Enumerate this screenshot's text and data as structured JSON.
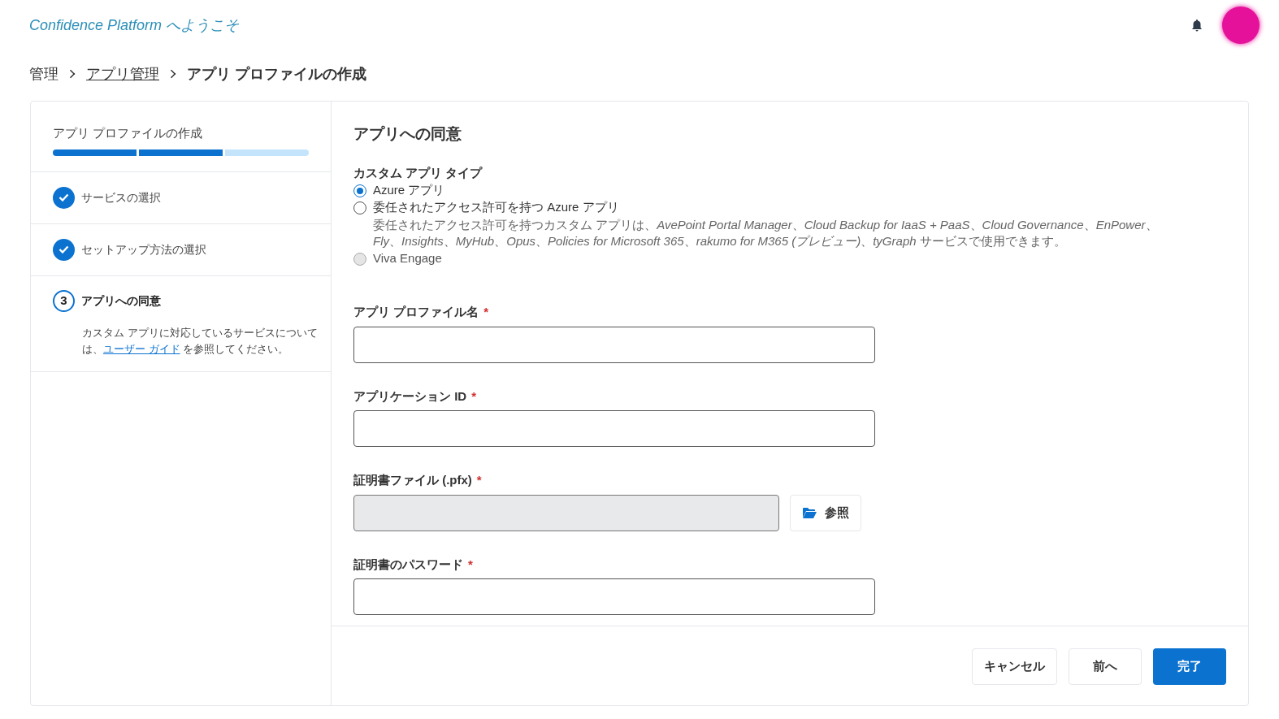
{
  "header": {
    "title": "Confidence Platform へようこそ"
  },
  "breadcrumb": [
    {
      "label": "管理",
      "link": false
    },
    {
      "label": "アプリ管理",
      "link": true
    },
    {
      "label": "アプリ プロファイルの作成",
      "link": false
    }
  ],
  "wizard": {
    "title": "アプリ プロファイルの作成",
    "progress": [
      {
        "filled": true
      },
      {
        "filled": true
      },
      {
        "filled": false
      }
    ],
    "steps": [
      {
        "completed": true,
        "selected": false,
        "label": "サービスの選択"
      },
      {
        "completed": true,
        "selected": false,
        "label": "セットアップ方法の選択"
      },
      {
        "completed": false,
        "selected": true,
        "marker": "3",
        "label": "アプリへの同意",
        "note_before": "カスタム アプリに対応しているサービスについては、",
        "note_link": "ユーザー ガイド",
        "note_after": " を参照してください。"
      }
    ]
  },
  "form": {
    "title": "アプリへの同意",
    "app_type": {
      "label": "カスタム アプリ タイプ",
      "options": [
        {
          "label": "Azure アプリ",
          "selected": true,
          "disabled": false
        },
        {
          "label": "委任されたアクセス許可を持つ Azure アプリ",
          "selected": false,
          "disabled": false,
          "description": "委任されたアクセス許可を持つカスタム アプリは、*AvePoint Portal Manager*、*Cloud Backup for IaaS + PaaS*、*Cloud Governance*、*EnPower*、*Fly*、*Insights*、*MyHub*、*Opus*、*Policies for Microsoft 365*、*rakumo for M365 (プレビュー)*、*tyGraph* サービスで使用できます。"
        },
        {
          "label": "Viva Engage",
          "selected": false,
          "disabled": true
        }
      ]
    },
    "fields": [
      {
        "kind": "text",
        "label": "アプリ プロファイル名",
        "required_mark": "*"
      },
      {
        "kind": "text",
        "label": "アプリケーション ID",
        "required_mark": "*"
      },
      {
        "kind": "file",
        "label": "証明書ファイル (.pfx)",
        "required_mark": "*",
        "button": "参照"
      },
      {
        "kind": "password",
        "label": "証明書のパスワード",
        "required_mark": "*"
      }
    ],
    "buttons": [
      {
        "label": "キャンセル",
        "primary": false
      },
      {
        "label": "前へ",
        "primary": false
      },
      {
        "label": "完了",
        "primary": true
      }
    ]
  }
}
